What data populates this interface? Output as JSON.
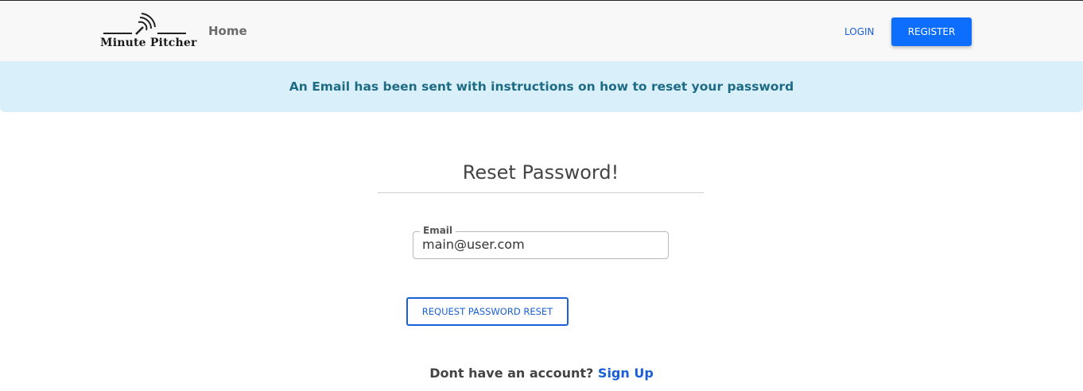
{
  "navbar": {
    "brand_name": "Minute Pitcher",
    "home_label": "Home",
    "login_label": "LOGIN",
    "register_label": "REGISTER"
  },
  "alert": {
    "message": "An Email has been sent with instructions on how to reset your password"
  },
  "form": {
    "title": "Reset Password!",
    "email_label": "Email",
    "email_value": "main@user.com",
    "submit_label": "REQUEST PASSWORD RESET"
  },
  "footer": {
    "prompt": "Dont have an account?",
    "signup_label": "Sign Up"
  },
  "colors": {
    "primary": "#0d6efd",
    "alert_bg": "#d9f0fa",
    "alert_text": "#1d6b85"
  }
}
